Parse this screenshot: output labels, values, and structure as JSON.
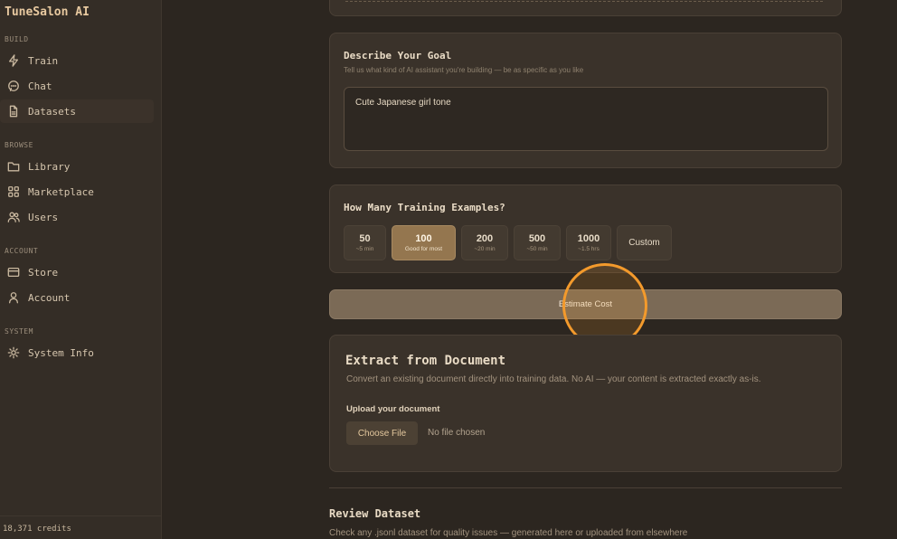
{
  "app": {
    "title": "TuneSalon AI",
    "credits": "18,371 credits"
  },
  "sidebar": {
    "sections": [
      "BUILD",
      "BROWSE",
      "ACCOUNT",
      "SYSTEM"
    ],
    "items": [
      {
        "label": "Train",
        "icon": "lightning-icon"
      },
      {
        "label": "Chat",
        "icon": "chat-bubble-icon"
      },
      {
        "label": "Datasets",
        "icon": "document-icon",
        "active": true
      },
      {
        "label": "Library",
        "icon": "folder-icon"
      },
      {
        "label": "Marketplace",
        "icon": "grid-icon"
      },
      {
        "label": "Users",
        "icon": "users-icon"
      },
      {
        "label": "Store",
        "icon": "card-icon"
      },
      {
        "label": "Account",
        "icon": "person-icon"
      },
      {
        "label": "System Info",
        "icon": "gear-icon"
      }
    ]
  },
  "goal": {
    "title": "Describe Your Goal",
    "hint": "Tell us what kind of AI assistant you're building — be as specific as you like",
    "value": "Cute Japanese girl tone"
  },
  "examples": {
    "title": "How Many Training Examples?",
    "options": [
      {
        "value": "50",
        "sub": "~5 min"
      },
      {
        "value": "100",
        "sub": "Good for most",
        "selected": true
      },
      {
        "value": "200",
        "sub": "~20 min"
      },
      {
        "value": "500",
        "sub": "~50 min"
      },
      {
        "value": "1000",
        "sub": "~1.5 hrs"
      },
      {
        "value": "Custom",
        "sub": ""
      }
    ]
  },
  "estimate_button": "Estimate Cost",
  "extract": {
    "title": "Extract from Document",
    "description": "Convert an existing document directly into training data. No AI — your content is extracted exactly as-is.",
    "upload_label": "Upload your document",
    "choose_file": "Choose File",
    "no_file": "No file chosen"
  },
  "review": {
    "title": "Review Dataset",
    "subtitle": "Check any .jsonl dataset for quality issues — generated here or uploaded from elsewhere"
  },
  "colors": {
    "accent": "#94764f",
    "cursor": "#f39a2c",
    "background": "#2c2620"
  }
}
